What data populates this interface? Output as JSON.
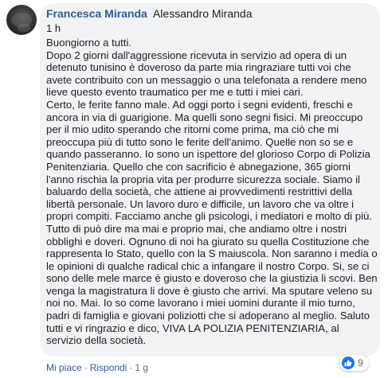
{
  "comment": {
    "author": "Francesca Miranda",
    "tagged_user": "Alessandro Miranda",
    "time": "1 h",
    "body_lines": [
      "Buongiorno a tutti.",
      "Dopo 2 giorni dall'aggressione ricevuta in servizio ad opera di un",
      "detenuto tunisino è doveroso da parte mia ringraziare tutti voi che",
      "avete contribuito con un messaggio o una telefonata a rendere meno",
      "lieve questo evento traumatico per me e tutti i miei cari.",
      "Certo, le ferite fanno male. Ad oggi porto i segni evidenti, freschi e",
      "ancora in via di guarigione. Ma quelli sono segni fisici. Mi preoccupo",
      "per il mio udito sperando che ritorni come prima, ma ciò che mi",
      "preoccupa più di tutto sono le ferite dell'animo. Quelle non so se e",
      "quando passeranno. Io sono un ispettore del glorioso Corpo di Polizia",
      "Penitenziaria. Quello che con sacrificio è abnegazione, 365 giorni",
      "l'anno rischia la propria vita per produrre sicurezza sociale. Siamo il",
      "baluardo della società, che attiene ai provvedimenti restrittivi della",
      "libertà personale. Un lavoro duro e difficile, un lavoro che va oltre i",
      "propri compiti. Facciamo anche gli psicologi, i mediatori e molto di più.",
      "Tutto di può dire ma mai e proprio mai, che andiamo oltre i nostri",
      "obblighi e doveri. Ognuno di noi ha giurato su quella Costituzione che",
      "rappresenta lo Stato, quello con la S maiuscola. Non saranno i media o",
      "le opinioni di qualche radical chic a infangare il nostro Corpo. Si, se ci",
      "sono delle mele marce è giusto e doveroso che la giustizia li scovi. Ben",
      "venga la magistratura li dove è giusto che arrivi. Ma sputare veleno su",
      "noi no. Mai. Io so come lavorano i miei uomini durante il mio turno,",
      "padri di famiglia e giovani poliziotti che si adoperano al meglio. Saluto",
      "tutti e vi ringrazio e dico, VIVA LA POLIZIA PENITENZIARIA, al",
      "servizio della società."
    ]
  },
  "actions": {
    "like": "Mi piace",
    "reply": "Rispondi",
    "age": "1 g",
    "separator": "·"
  },
  "reactions": {
    "count": "9",
    "icon": "like-icon",
    "color": "#1877f2"
  }
}
